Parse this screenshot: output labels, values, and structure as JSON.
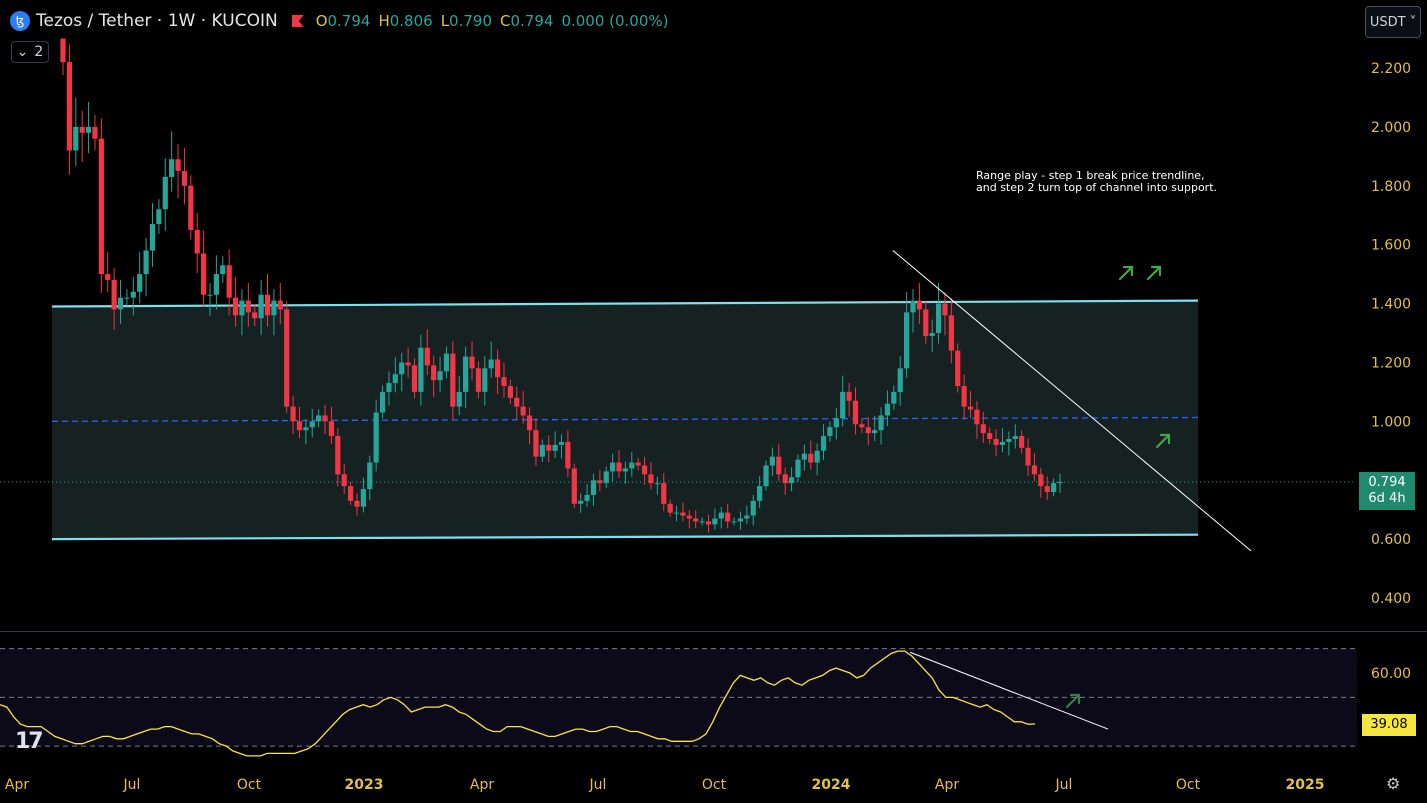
{
  "header": {
    "logo_glyph": "ꜩ",
    "title": "Tezos / Tether · 1W · KUCOIN",
    "open_label": "O",
    "open": "0.794",
    "high_label": "H",
    "high": "0.806",
    "low_label": "L",
    "low": "0.790",
    "close_label": "C",
    "close": "0.794",
    "change": "0.000 (0.00%)"
  },
  "collapse": {
    "icon": "chevron-down-icon",
    "count": "2"
  },
  "currency_button": "USDT ˅",
  "annotation": "Range play - step 1 break price trendline,\nand step 2 turn top of channel into support.",
  "last_price": {
    "price": "0.794",
    "countdown": "6d 4h",
    "color": "#1f8a6e"
  },
  "rsi_value": {
    "value": "39.08",
    "color": "#f6e73f"
  },
  "colors": {
    "up": "#26a69a",
    "down": "#f23645",
    "channel": "#7ee0ee",
    "rsi_line": "#f6e73f",
    "arrow": "#3fa84a"
  },
  "chart_data": {
    "type": "candlestick",
    "title": "Tezos / Tether · 1W · KUCOIN",
    "x_ticks": [
      "Apr",
      "Jul",
      "Oct",
      "2023",
      "Apr",
      "Jul",
      "Oct",
      "2024",
      "Apr",
      "Jul",
      "Oct",
      "2025"
    ],
    "x_tick_dates": [
      "2022-04-01",
      "2022-07-01",
      "2022-10-01",
      "2023-01-01",
      "2023-04-01",
      "2023-07-01",
      "2023-10-01",
      "2024-01-01",
      "2024-04-01",
      "2024-07-01",
      "2024-10-01",
      "2025-01-01"
    ],
    "price_axis": {
      "ticks": [
        2.2,
        2.0,
        1.8,
        1.6,
        1.4,
        1.2,
        1.0,
        0.8,
        0.6,
        0.4
      ],
      "tick_labels": [
        "2.200",
        "2.000",
        "1.800",
        "1.600",
        "1.400",
        "1.200",
        "1.000",
        "0.800",
        "0.600",
        "0.400"
      ],
      "range": [
        0.33,
        2.27
      ]
    },
    "closes": [
      2.22,
      1.92,
      2.0,
      1.98,
      2.0,
      1.96,
      1.5,
      1.48,
      1.38,
      1.42,
      1.42,
      1.44,
      1.5,
      1.58,
      1.67,
      1.72,
      1.83,
      1.89,
      1.85,
      1.8,
      1.65,
      1.57,
      1.43,
      1.43,
      1.5,
      1.53,
      1.42,
      1.36,
      1.41,
      1.37,
      1.35,
      1.43,
      1.36,
      1.41,
      1.38,
      1.05,
      1.0,
      0.97,
      0.98,
      1.0,
      1.02,
      1.0,
      0.95,
      0.82,
      0.78,
      0.73,
      0.71,
      0.77,
      0.86,
      1.03,
      1.1,
      1.13,
      1.16,
      1.2,
      1.19,
      1.1,
      1.25,
      1.19,
      1.14,
      1.17,
      1.23,
      1.05,
      1.1,
      1.22,
      1.18,
      1.1,
      1.18,
      1.21,
      1.15,
      1.12,
      1.08,
      1.05,
      1.02,
      0.97,
      0.88,
      0.92,
      0.9,
      0.92,
      0.93,
      0.84,
      0.72,
      0.73,
      0.75,
      0.8,
      0.79,
      0.83,
      0.86,
      0.83,
      0.84,
      0.86,
      0.85,
      0.82,
      0.79,
      0.79,
      0.72,
      0.69,
      0.69,
      0.68,
      0.67,
      0.66,
      0.66,
      0.65,
      0.67,
      0.69,
      0.66,
      0.66,
      0.67,
      0.68,
      0.73,
      0.78,
      0.85,
      0.88,
      0.82,
      0.79,
      0.81,
      0.87,
      0.89,
      0.86,
      0.9,
      0.95,
      0.98,
      1.01,
      1.1,
      1.07,
      0.99,
      0.98,
      0.96,
      0.97,
      1.02,
      1.06,
      1.1,
      1.18,
      1.37,
      1.41,
      1.38,
      1.29,
      1.3,
      1.4,
      1.36,
      1.24,
      1.12,
      1.05,
      1.04,
      0.99,
      0.96,
      0.94,
      0.92,
      0.93,
      0.94,
      0.95,
      0.91,
      0.85,
      0.82,
      0.78,
      0.76,
      0.79,
      0.794
    ],
    "channel": {
      "upper": [
        1.39,
        1.41
      ],
      "lower": [
        0.6,
        0.615
      ],
      "mid": 1.0
    },
    "trendline": {
      "from": 1.58,
      "to": 0.56
    },
    "rsi": {
      "ticks": [
        60,
        39.08
      ],
      "tick_labels": [
        "60.00"
      ],
      "values": [
        47,
        46,
        42,
        39,
        38,
        38,
        38,
        36,
        34,
        33,
        32,
        31,
        31,
        32,
        33,
        34,
        34,
        33,
        33,
        34,
        35,
        36,
        37,
        37,
        38,
        38,
        37,
        36,
        35,
        35,
        34,
        33,
        31,
        30,
        28,
        27,
        26,
        26,
        26,
        27,
        27,
        27,
        27,
        27,
        28,
        29,
        31,
        34,
        37,
        40,
        43,
        45,
        46,
        47,
        46,
        47,
        49,
        50,
        49,
        47,
        44,
        45,
        46,
        46,
        46,
        47,
        46,
        44,
        43,
        41,
        39,
        37,
        36,
        36,
        38,
        38,
        38,
        37,
        36,
        35,
        34,
        34,
        35,
        36,
        37,
        37,
        36,
        36,
        37,
        38,
        38,
        37,
        36,
        36,
        35,
        34,
        33,
        33,
        32,
        32,
        32,
        32,
        33,
        35,
        40,
        46,
        51,
        56,
        59,
        58,
        57,
        58,
        56,
        55,
        57,
        58,
        56,
        55,
        57,
        58,
        59,
        61,
        62,
        61,
        60,
        58,
        59,
        62,
        64,
        66,
        68,
        69,
        69,
        67,
        64,
        61,
        58,
        53,
        50,
        50,
        49,
        48,
        47,
        46,
        47,
        45,
        44,
        42,
        40,
        40,
        39,
        39.08
      ]
    }
  }
}
